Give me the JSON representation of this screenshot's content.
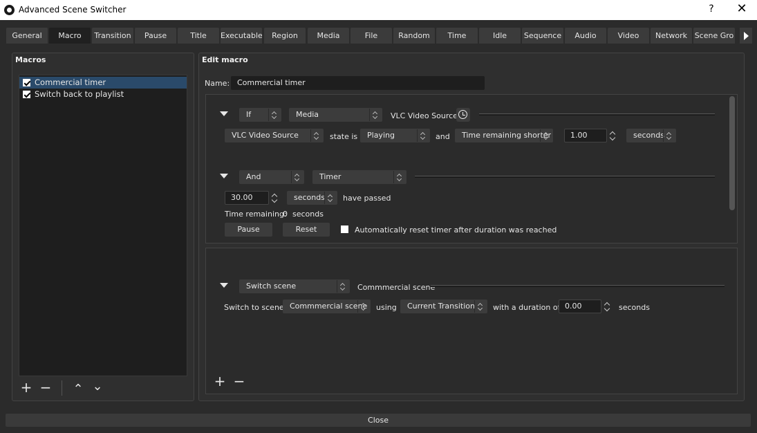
{
  "window": {
    "title": "Advanced Scene Switcher",
    "help": "?",
    "close": "✕"
  },
  "tabs": [
    "General",
    "Macro",
    "Transition",
    "Pause",
    "Title",
    "Executable",
    "Region",
    "Media",
    "File",
    "Random",
    "Time",
    "Idle",
    "Sequence",
    "Audio",
    "Video",
    "Network",
    "Scene Gro"
  ],
  "macros_panel": {
    "title": "Macros",
    "items": [
      {
        "label": "Commercial timer",
        "checked": true,
        "selected": true
      },
      {
        "label": "Switch back to playlist",
        "checked": true,
        "selected": false
      }
    ],
    "add": "+",
    "remove": "−",
    "up": "⌃",
    "down": "⌄"
  },
  "edit": {
    "title": "Edit macro",
    "name_label": "Name:",
    "name_value": "Commercial timer",
    "cond1": {
      "logic": "If",
      "type": "Media",
      "source_label": "VLC Video Source",
      "source": "VLC Video Source",
      "state_is": "state is",
      "state": "Playing",
      "and": "and",
      "check": "Time remaining shorter",
      "value": "1.00",
      "unit": "seconds"
    },
    "cond2": {
      "logic": "And",
      "type": "Timer",
      "duration": "30.00",
      "unit": "seconds",
      "have_passed": "have passed",
      "remaining_label": "Time remaining:",
      "remaining_value": "0",
      "remaining_unit": "seconds",
      "pause": "Pause",
      "reset": "Reset",
      "auto_reset": "Automatically reset timer after duration was reached"
    },
    "action": {
      "type": "Switch scene",
      "scene_label": "Commmercial scene",
      "switch_to": "Switch to scene",
      "scene": "Commmercial scene",
      "using": "using",
      "transition": "Current Transition",
      "with_duration": "with a duration of",
      "duration": "0.00",
      "unit": "seconds"
    },
    "add": "+",
    "remove": "−"
  },
  "close_button": "Close"
}
